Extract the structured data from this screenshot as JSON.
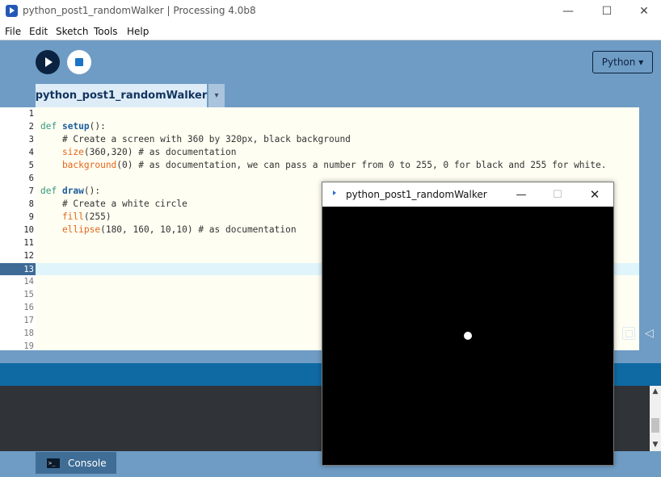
{
  "window": {
    "title": "python_post1_randomWalker | Processing 4.0b8",
    "minimize_glyph": "—",
    "maximize_glyph": "☐",
    "close_glyph": "✕"
  },
  "menu": [
    "File",
    "Edit",
    "Sketch",
    "Tools",
    "Help"
  ],
  "toolbar": {
    "mode_label": "Python ▾"
  },
  "tab": {
    "label": "python_post1_randomWalker",
    "menu_glyph": "▾"
  },
  "editor": {
    "active_line": 13,
    "line_numbers": [
      "1",
      "2",
      "3",
      "4",
      "5",
      "6",
      "7",
      "8",
      "9",
      "10",
      "11",
      "12",
      "13",
      "14",
      "15",
      "16",
      "17",
      "18",
      "19"
    ],
    "lines": {
      "l2_kw": "def ",
      "l2_fn": "setup",
      "l2_rest": "():",
      "l3": "    # Create a screen with 360 by 320px, black background",
      "l4_fn": "    size",
      "l4_rest": "(360,320) # as documentation",
      "l5_fn": "    background",
      "l5_rest": "(0) # as documentation, we can pass a number from 0 to 255, 0 for black and 255 for white.",
      "l7_kw": "def ",
      "l7_fn": "draw",
      "l7_rest": "():",
      "l8": "    # Create a white circle",
      "l9_fn": "    fill",
      "l9_rest": "(255)",
      "l10_fn": "    ellipse",
      "l10_rest": "(180, 160, 10,10) # as documentation"
    }
  },
  "console": {
    "tab_label": "Console",
    "up_glyph": "▲",
    "down_glyph": "▼",
    "collapse_glyph": "◁"
  },
  "sketch_window": {
    "title": "python_post1_randomWalker",
    "minimize_glyph": "—",
    "maximize_glyph": "☐",
    "close_glyph": "✕",
    "canvas_background": "#000000",
    "circle_color": "#ffffff"
  },
  "colors": {
    "ide_background": "#6f9cc4",
    "editor_background": "#fffef2",
    "status_bar": "#0f6aa4",
    "console_background": "#303438",
    "tab_active": "#ddecf7"
  },
  "icons": {
    "run": "play-icon",
    "stop": "stop-icon",
    "copy": "console-copy-icon",
    "collapse": "collapse-arrow-icon",
    "console": "terminal-icon"
  }
}
